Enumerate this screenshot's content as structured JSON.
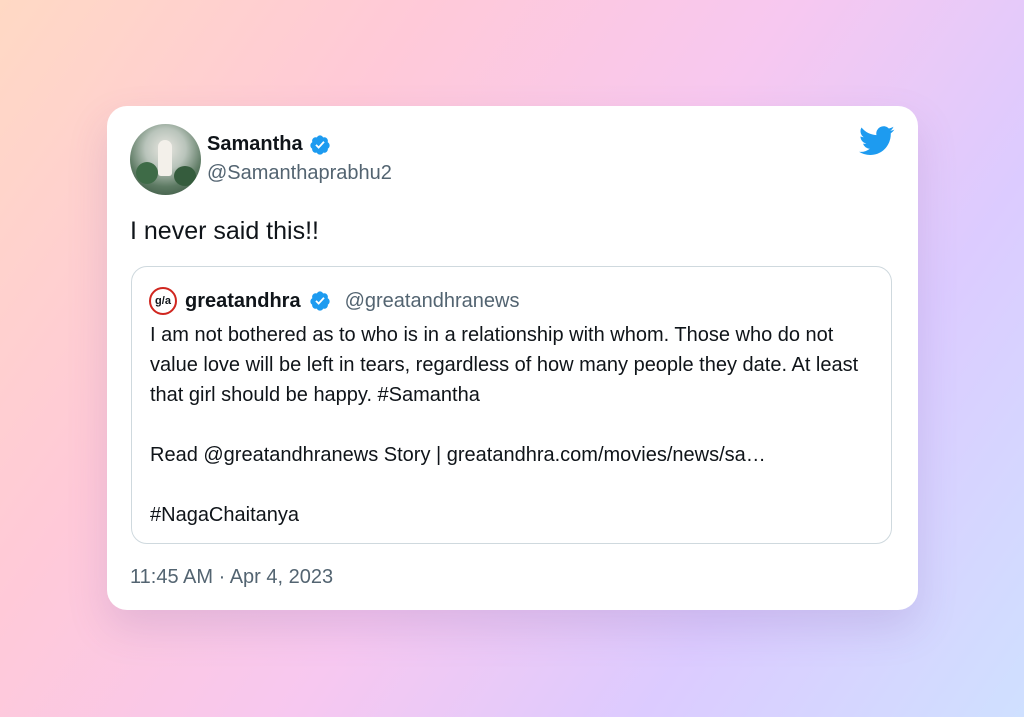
{
  "tweet": {
    "author_name": "Samantha",
    "author_handle": "@Samanthaprabhu2",
    "text": "I never said this!!",
    "timestamp": "11:45 AM · Apr 4, 2023"
  },
  "quote": {
    "logo_text": "g/a",
    "author_name": "greatandhra",
    "author_handle": "@greatandhranews",
    "paragraph1": "I am not bothered as to who is in a relationship with whom. Those who do not value love will be left in tears, regardless of how many people they date. At least that girl should be happy. #Samantha",
    "paragraph2": "Read @greatandhranews Story | greatandhra.com/movies/news/sa…",
    "paragraph3": "#NagaChaitanya"
  },
  "colors": {
    "verified": "#1d9bf0",
    "twitter_blue": "#1d9bf0",
    "text": "#0f1419",
    "muted": "#536471",
    "border": "#cfd9de"
  },
  "icons": [
    "verified-badge-icon",
    "twitter-bird-icon",
    "greatandhra-logo-icon"
  ]
}
